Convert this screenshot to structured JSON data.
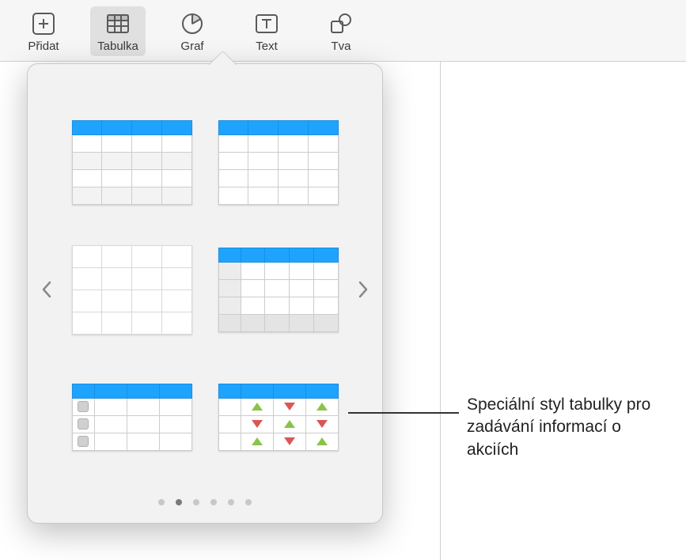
{
  "toolbar": {
    "items": [
      {
        "label": "Přidat",
        "icon": "plus-box"
      },
      {
        "label": "Tabulka",
        "icon": "table",
        "active": true
      },
      {
        "label": "Graf",
        "icon": "pie"
      },
      {
        "label": "Text",
        "icon": "text-box"
      },
      {
        "label": "Tva",
        "icon": "shapes"
      }
    ]
  },
  "popover": {
    "page_count": 6,
    "active_page_index": 1,
    "thumbs": [
      {
        "name": "table-style-header-alt-rows"
      },
      {
        "name": "table-style-header-plain"
      },
      {
        "name": "table-style-plain-grid"
      },
      {
        "name": "table-style-header-rowcol-footer"
      },
      {
        "name": "table-style-checklist"
      },
      {
        "name": "table-style-stock-arrows"
      }
    ]
  },
  "callout": {
    "text": "Speciální styl tabulky pro zadávání informací o akciích"
  },
  "colors": {
    "header_blue": "#1ea4ff",
    "arrow_up": "#8bc34a",
    "arrow_down": "#d95757"
  }
}
